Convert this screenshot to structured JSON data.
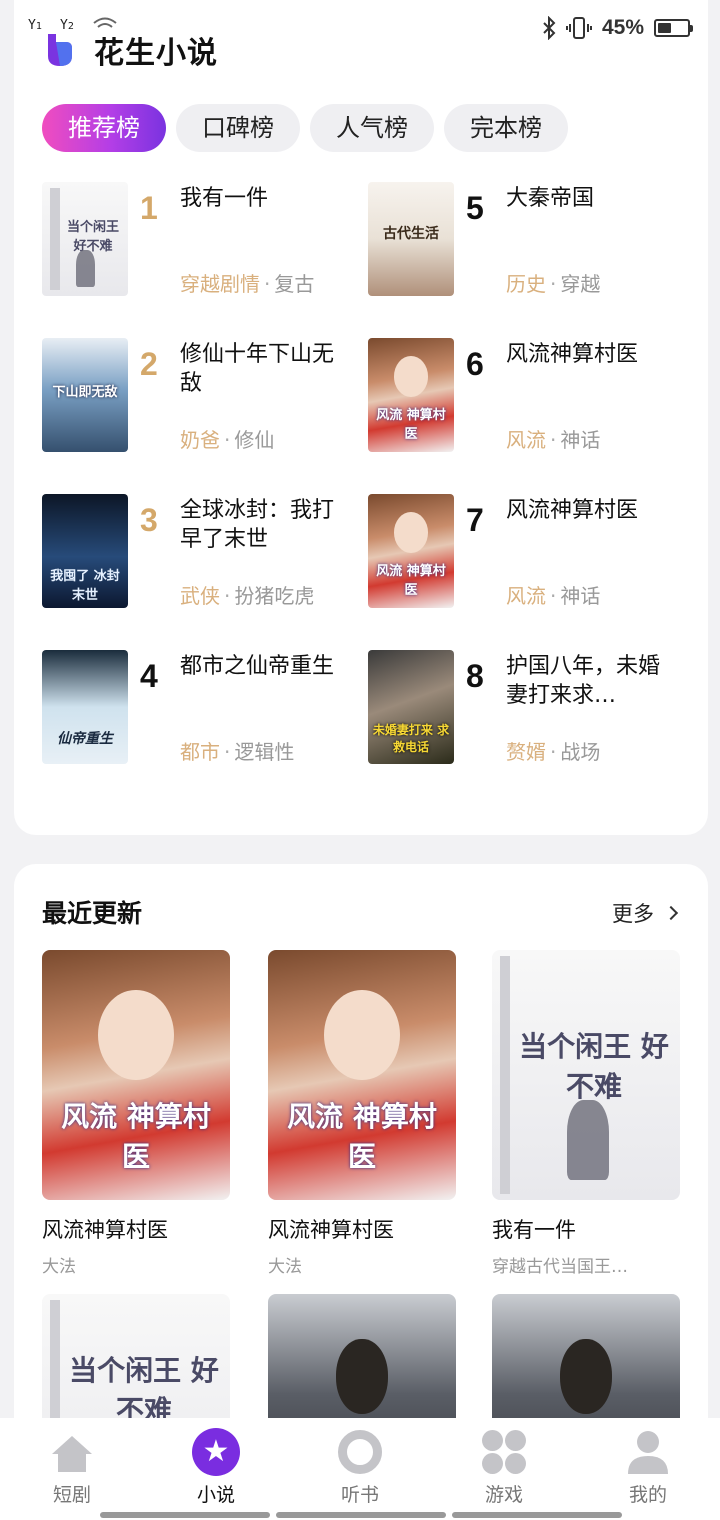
{
  "status_bar": {
    "sim1": "1",
    "sim2": "2",
    "battery_percent_text": "45%",
    "battery_level": 0.45
  },
  "app": {
    "title": "花生小说"
  },
  "tabs": [
    {
      "label": "推荐榜",
      "active": true
    },
    {
      "label": "口碑榜",
      "active": false
    },
    {
      "label": "人气榜",
      "active": false
    },
    {
      "label": "完本榜",
      "active": false
    }
  ],
  "ranking": [
    {
      "rank": "1",
      "title": "我有一件",
      "tag1": "穿越剧情",
      "tag2": "复古"
    },
    {
      "rank": "2",
      "title": "修仙十年下山无敌",
      "tag1": "奶爸",
      "tag2": "修仙"
    },
    {
      "rank": "3",
      "title": "全球冰封：我打早了末世",
      "tag1": "武侠",
      "tag2": "扮猪吃虎"
    },
    {
      "rank": "4",
      "title": "都市之仙帝重生",
      "tag1": "都市",
      "tag2": "逻辑性"
    },
    {
      "rank": "5",
      "title": "大秦帝国",
      "tag1": "历史",
      "tag2": "穿越"
    },
    {
      "rank": "6",
      "title": "风流神算村医",
      "tag1": "风流",
      "tag2": "神话"
    },
    {
      "rank": "7",
      "title": "风流神算村医",
      "tag1": "风流",
      "tag2": "神话"
    },
    {
      "rank": "8",
      "title": "护国八年，未婚妻打来求…",
      "tag1": "赘婿",
      "tag2": "战场"
    }
  ],
  "covers": {
    "c1": "当个闲王 好不难",
    "c2": "下山即无敌",
    "c3": "我囤了 冰封末世",
    "c4": "仙帝重生",
    "c5": "古代生活",
    "c6": "风流 神算村医",
    "c8": "未婚妻打来 求救电话"
  },
  "recent": {
    "title": "最近更新",
    "more_label": "更多",
    "books": [
      {
        "title": "风流神算村医",
        "sub": "大法"
      },
      {
        "title": "风流神算村医",
        "sub": "大法"
      },
      {
        "title": "我有一件",
        "sub": "穿越古代当国王…"
      }
    ]
  },
  "bottom_nav": [
    {
      "label": "短剧",
      "icon": "home-icon",
      "active": false
    },
    {
      "label": "小说",
      "icon": "star-icon",
      "active": true
    },
    {
      "label": "听书",
      "icon": "ring-icon",
      "active": false
    },
    {
      "label": "游戏",
      "icon": "clover-icon",
      "active": false
    },
    {
      "label": "我的",
      "icon": "person-icon",
      "active": false
    }
  ],
  "colors": {
    "accent_gradient_start": "#f04dbf",
    "accent_gradient_end": "#7a33e0",
    "rank_gold": "#d4a86a",
    "tag_gold": "#d9b07e",
    "nav_active": "#7a2de0"
  }
}
